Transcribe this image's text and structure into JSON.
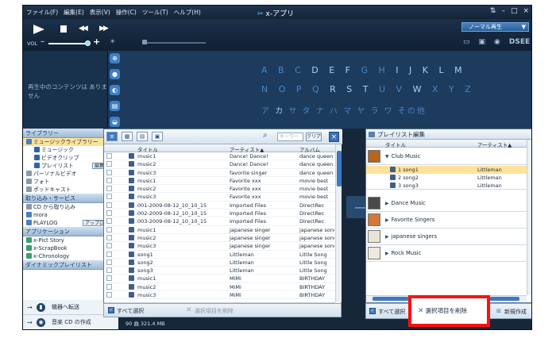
{
  "app": {
    "title": "x-アプリ",
    "menus": [
      "ファイル(F)",
      "編集(E)",
      "表示(V)",
      "操作(C)",
      "ツール(T)",
      "ヘルプ(H)"
    ],
    "window_controls": [
      "⇅",
      "–",
      "□",
      "×"
    ]
  },
  "transport": {
    "vol_label": "VOL",
    "mode": "ノーマル再生",
    "dsee": "DSEE"
  },
  "info": {
    "no_content": "再生中のコンテンツは ありません"
  },
  "browse": {
    "alpha_row1": "ABCDEFGHIJKLM",
    "alpha_row2": "NOPQRSTUVWXYZ",
    "kana_row": "ア カ サ タ ナ ハ マ ヤ ラ ワ その他"
  },
  "left_panel": {
    "library_header": "ライブラリー",
    "items": [
      {
        "label": "ミュージックライブラリー",
        "sub": false,
        "selected": true
      },
      {
        "label": "ミュージック",
        "sub": true
      },
      {
        "label": "ビデオクリップ",
        "sub": true
      },
      {
        "label": "プレイリスト",
        "sub": true,
        "button": "編集終了"
      },
      {
        "label": "パーソナルビデオ",
        "sub": false
      },
      {
        "label": "フォト",
        "sub": false
      },
      {
        "label": "ポッドキャスト",
        "sub": false
      }
    ],
    "import_header": "取り込み・サービス",
    "import_items": [
      {
        "label": "CD から取り込み"
      },
      {
        "label": "mora"
      },
      {
        "label": "PLAYLOG",
        "button": "アップロード"
      }
    ],
    "apps_header": "アプリケーション",
    "app_items": [
      {
        "label": "x-Pict Story"
      },
      {
        "label": "x-ScrapBook"
      },
      {
        "label": "x-Chronology"
      }
    ],
    "partial_header": "ダイナミックプレイリスト",
    "transfer_label": "機器へ転送",
    "cd_label": "音楽 CD の作成"
  },
  "main": {
    "search_placeholder": "キーワー",
    "clear_label": "クリア",
    "columns": [
      "タイトル",
      "アーティスト▲",
      "アルバム"
    ],
    "rows": [
      [
        "music1",
        "Dance! Dance!",
        "dance queen"
      ],
      [
        "music2",
        "Dance! Dance!",
        "dance queen"
      ],
      [
        "music3",
        "favorite singer",
        "dance queen"
      ],
      [
        "music1",
        "Favorite xxx",
        "movie best"
      ],
      [
        "music2",
        "Favorite xxx",
        "movie best"
      ],
      [
        "music3",
        "Favorite xxx",
        "movie best"
      ],
      [
        "001-2009-08-12_10_10_15",
        "Imported Files",
        "DirectRec"
      ],
      [
        "002-2009-08-12_10_10_15",
        "Imported Files",
        "DirectRec"
      ],
      [
        "003-2009-08-12_10_10_15",
        "Imported Files",
        "DirectRec"
      ],
      [
        "music1",
        "japanese singer",
        "japanese song"
      ],
      [
        "music2",
        "japanese singer",
        "japanese song"
      ],
      [
        "music3",
        "japanese singer",
        "japanese song"
      ],
      [
        "song1",
        "Littleman",
        "Little Song"
      ],
      [
        "song2",
        "Littleman",
        "Little Song"
      ],
      [
        "song3",
        "Littleman",
        "Little Song"
      ],
      [
        "music1",
        "MiMi",
        "BIRTHDAY"
      ],
      [
        "music2",
        "MiMi",
        "BIRTHDAY"
      ],
      [
        "music3",
        "MiMi",
        "BIRTHDAY"
      ]
    ],
    "select_all": "すべて選択",
    "delete_selected": "選択項目を削除",
    "status": "90 曲 321.4 MB"
  },
  "playlist": {
    "title": "プレイリスト編集",
    "columns": [
      "タイトル",
      "アーティスト▲"
    ],
    "groups": [
      {
        "label": "Club Music",
        "open": true,
        "songs": [
          {
            "title": "1 song1",
            "artist": "Littleman",
            "selected": true
          },
          {
            "title": "2 song2",
            "artist": "Littleman"
          },
          {
            "title": "3 song3",
            "artist": "Littleman"
          }
        ]
      },
      {
        "label": "Dance Music"
      },
      {
        "label": "Favorite Singers"
      },
      {
        "label": "japanese singers"
      },
      {
        "label": "Rock Music"
      }
    ],
    "select_all": "すべて選択",
    "delete_selected": "選択項目を削除",
    "new_playlist": "新規作成"
  },
  "colors": {
    "app_bg": "#17273a",
    "accent": "#3f79c0",
    "selected_row": "#ffe29a",
    "highlight_box": "#ff1010"
  }
}
